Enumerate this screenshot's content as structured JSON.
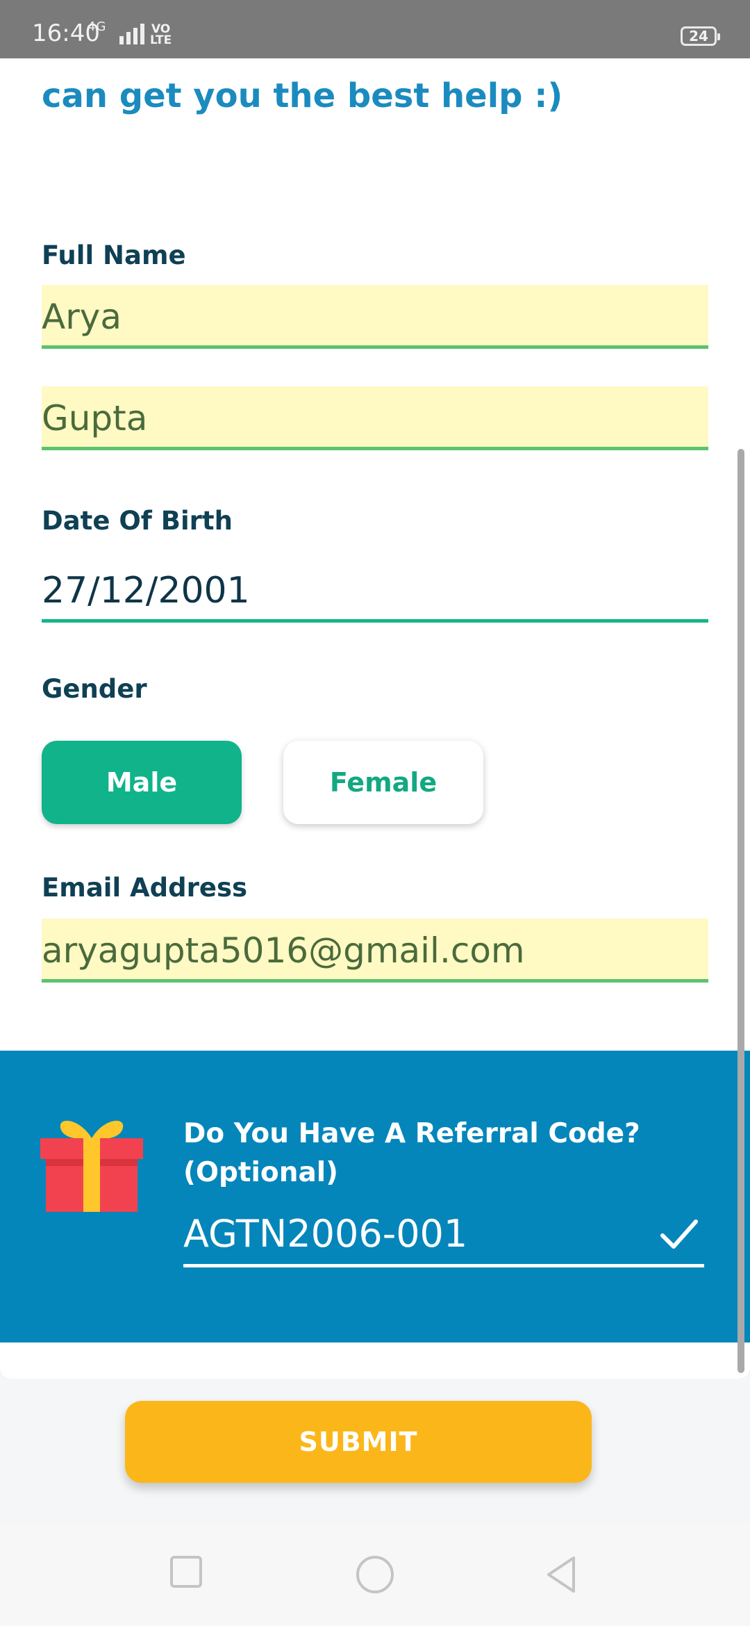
{
  "status_bar": {
    "time": "16:40",
    "network": "4G",
    "volte": "VO\nLTE",
    "battery": "24"
  },
  "intro_text": "can get you the best help :)",
  "form": {
    "full_name_label": "Full Name",
    "first_name_value": "Arya",
    "last_name_value": "Gupta",
    "dob_label": "Date Of Birth",
    "dob_value": "27/12/2001",
    "gender_label": "Gender",
    "gender_options": [
      "Male",
      "Female"
    ],
    "gender_selected": "Male",
    "email_label": "Email Address",
    "email_value": "aryagupta5016@gmail.com"
  },
  "referral": {
    "title": "Do You Have A Referral Code? (Optional)",
    "code_value": "AGTN2006-001"
  },
  "submit_label": "SUBMIT",
  "colors": {
    "accent_green": "#10b38a",
    "referral_blue": "#0586bb",
    "submit_yellow": "#fbb71a",
    "autofill_bg": "#fff9c4"
  }
}
